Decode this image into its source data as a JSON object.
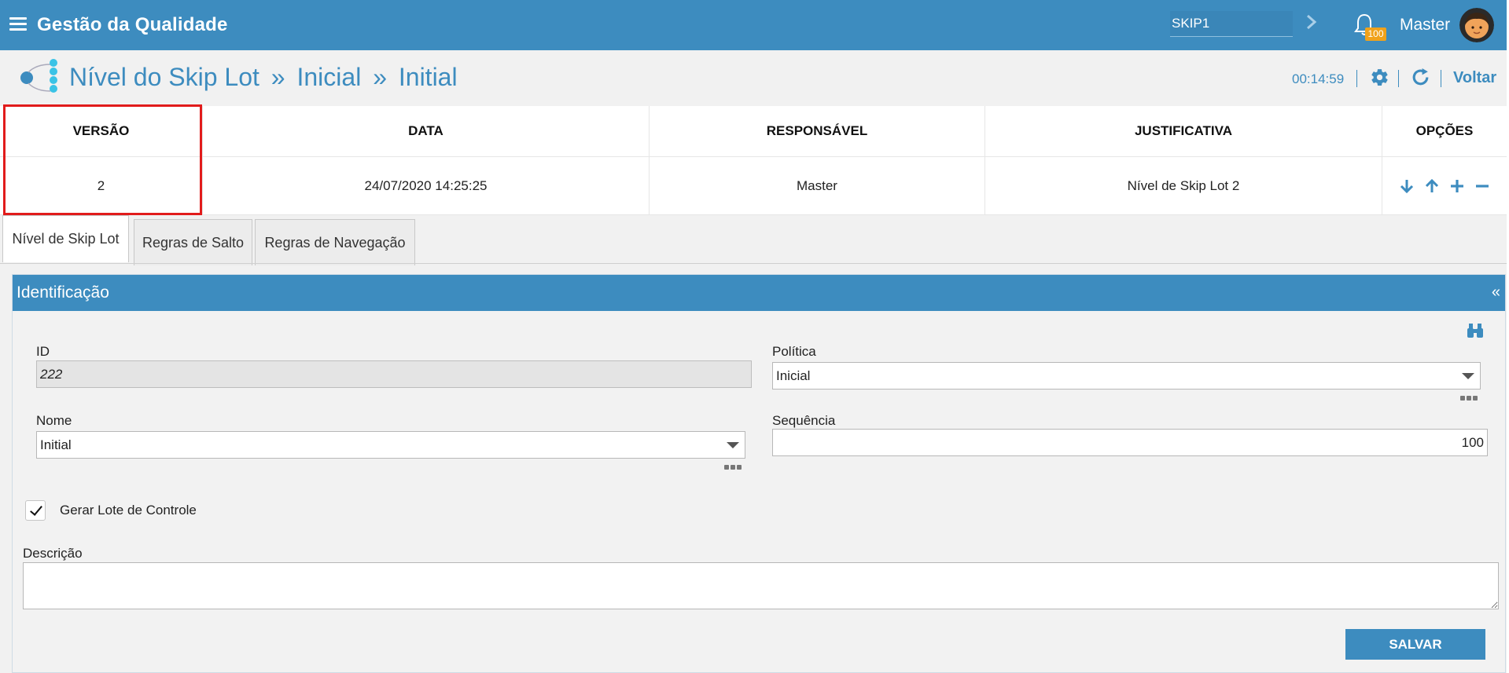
{
  "app": {
    "title": "Gestão da Qualidade",
    "code_value": "SKIP1",
    "notifications_count": "100",
    "user_name": "Master",
    "accent": "#3d8cbf"
  },
  "header": {
    "title_parts": [
      "Nível do Skip Lot",
      "Inicial",
      "Initial"
    ],
    "separator": "»",
    "timer": "00:14:59",
    "back_label": "Voltar",
    "icons": [
      "gear-icon",
      "refresh-icon"
    ]
  },
  "versions": {
    "columns": [
      "VERSÃO",
      "DATA",
      "RESPONSÁVEL",
      "JUSTIFICATIVA",
      "OPÇÕES"
    ],
    "rows": [
      {
        "version": "2",
        "date": "24/07/2020 14:25:25",
        "responsible": "Master",
        "justification": "Nível de Skip Lot 2"
      }
    ],
    "option_icons": [
      "arrow-down-icon",
      "arrow-up-icon",
      "plus-icon",
      "minus-icon"
    ],
    "highlight_color": "#e11b1b"
  },
  "tabs": [
    {
      "label": "Nível de Skip Lot",
      "active": true
    },
    {
      "label": "Regras de Salto",
      "active": false
    },
    {
      "label": "Regras de Navegação",
      "active": false
    }
  ],
  "form": {
    "section_title": "Identificação",
    "collapse_symbol": "«",
    "id_label": "ID",
    "id_value": "222",
    "policy_label": "Política",
    "policy_value": "Inicial",
    "name_label": "Nome",
    "name_value": "Initial",
    "sequence_label": "Sequência",
    "sequence_value": "100",
    "generate_lot_label": "Gerar Lote de Controle",
    "generate_lot_checked": true,
    "description_label": "Descrição",
    "description_value": "",
    "save_label": "SALVAR"
  }
}
